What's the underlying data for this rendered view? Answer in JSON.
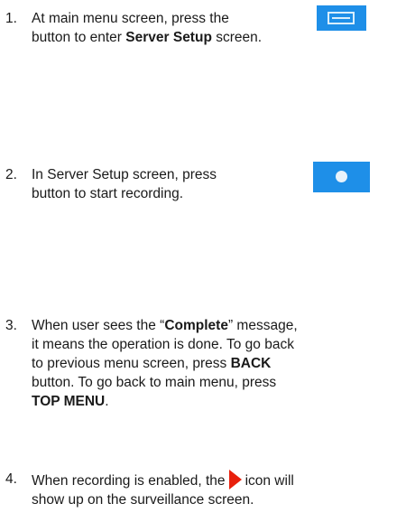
{
  "steps": [
    {
      "number": "1.",
      "line1_a": "At main menu screen, press the",
      "line2_bold": "Server Setup",
      "line2_c": "button to enter ",
      "line2_e": " screen.",
      "icon": "server-setup-button-icon"
    },
    {
      "number": "2.",
      "line1": "In Server Setup screen, press",
      "line2": "button to start recording.",
      "icon": "record-button-icon"
    },
    {
      "number": "3.",
      "line1_a": "When user sees the “",
      "line1_bold": "Complete",
      "line1_c": "” message,",
      "line2": "it means the operation is done. To go back",
      "line3_a": "to previous menu screen, press ",
      "line3_bold": "BACK",
      "line4": "button. To go back to main menu, press",
      "line5_bold": "TOP MENU",
      "line5_c": "."
    },
    {
      "number": "4.",
      "line1_a": "When recording is enabled, the",
      "line1_c": "icon will",
      "line2": "show up on the surveillance screen.",
      "icon": "recording-indicator-icon"
    }
  ],
  "colors": {
    "button_blue": "#1e8fe8",
    "indicator_red": "#e8200c"
  }
}
